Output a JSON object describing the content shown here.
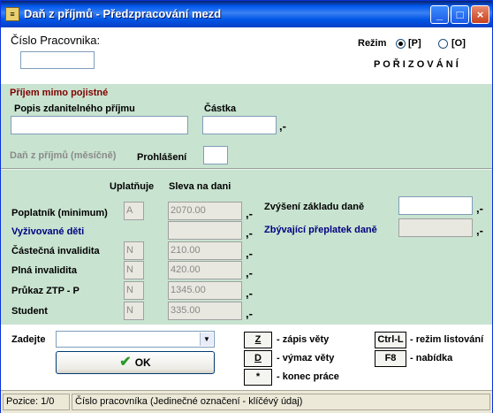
{
  "window": {
    "title": "Daň z příjmů - Předzpracování mezd",
    "icon": "app-icon",
    "controls": [
      "minimize-icon",
      "maximize-icon",
      "close-icon"
    ]
  },
  "header": {
    "employee_label": "Číslo Pracovnika:",
    "employee_value": "",
    "mode_label": "Režim",
    "mode_options": [
      "[P]",
      "[O]"
    ],
    "mode_selected": "[P]",
    "mode_name": "P O Ř I Z O V Á N Í"
  },
  "income": {
    "section_title": "Příjem mimo pojistné",
    "description_label": "Popis zdanitelného příjmu",
    "description_value": "",
    "amount_label": "Částka",
    "amount_value": "",
    "amount_dash": ",-",
    "tax_label": "Daň z příjmů (měsíčně)",
    "declaration_label": "Prohlášení",
    "declaration_value": ""
  },
  "discounts": {
    "col_applies": "Uplatňuje",
    "col_discount": "Sleva na dani",
    "rows": [
      {
        "label": "Poplatník (minimum)",
        "flag": "A",
        "amount": "2070.00",
        "dash": ",-"
      },
      {
        "label": "Vyživované děti",
        "flag": "",
        "amount": "",
        "dash": ",-"
      },
      {
        "label": "Částečná invalidita",
        "flag": "N",
        "amount": "210.00",
        "dash": ",-"
      },
      {
        "label": "Plná invalidita",
        "flag": "N",
        "amount": "420.00",
        "dash": ",-"
      },
      {
        "label": "Průkaz ZTP - P",
        "flag": "N",
        "amount": "1345.00",
        "dash": ",-"
      },
      {
        "label": "Student",
        "flag": "N",
        "amount": "335.00",
        "dash": ",-"
      }
    ],
    "increase_label": "Zvýšení základu daně",
    "increase_value": "",
    "overpay_label": "Zbývající přeplatek daně",
    "overpay_value": "",
    "dash": ",-"
  },
  "bottom": {
    "enter_label": "Zadejte",
    "enter_value": "",
    "ok_label": "OK",
    "keys": [
      {
        "key": "Z",
        "desc": "- zápis věty"
      },
      {
        "key": "D",
        "desc": "- výmaz věty"
      },
      {
        "key": "*",
        "desc": "- konec práce"
      },
      {
        "key": "Ctrl-L",
        "desc": "- režim listování"
      },
      {
        "key": "F8",
        "desc": "- nabídka"
      }
    ]
  },
  "status": {
    "position": "Pozice: 1/0",
    "message": "Číslo pracovníka (Jedinečné označení - klíčévý údaj)"
  },
  "colors": {
    "panel": "#c8e3d0",
    "section_title": "#800000",
    "highlight_label": "#000080",
    "titlebar": "#0058ee"
  }
}
